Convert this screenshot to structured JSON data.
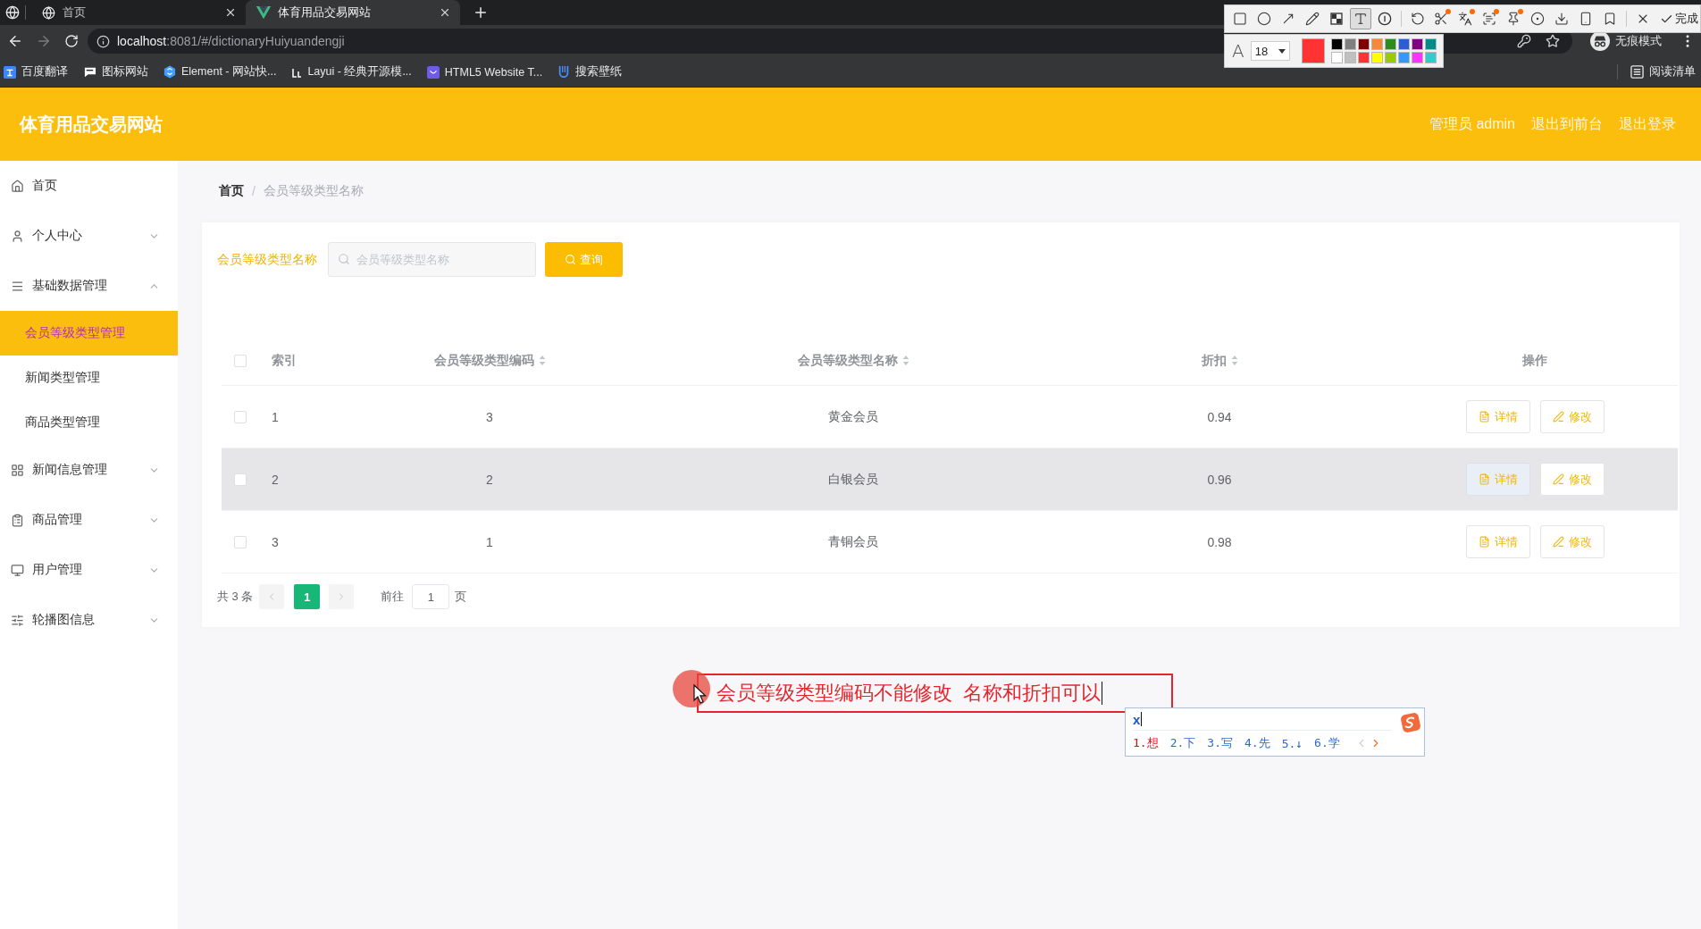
{
  "browser": {
    "tabs": [
      {
        "title": "首页",
        "selected": false
      },
      {
        "title": "体育用品交易网站",
        "selected": true
      }
    ],
    "address": {
      "host": "localhost",
      "path": ":8081/#/dictionaryHuiyuandengji"
    },
    "profile": "无痕模式",
    "bookmarks": [
      "百度翻译",
      "图标网站",
      "Element - 网站快...",
      "Layui - 经典开源模...",
      "HTML5 Website T...",
      "搜索壁纸"
    ],
    "reading_list": "阅读清单"
  },
  "capture_toolbar": {
    "tools": [
      {
        "selected": false,
        "badge": false
      },
      {
        "selected": false,
        "badge": false
      },
      {
        "selected": false,
        "badge": false
      },
      {
        "selected": false,
        "badge": false
      },
      {
        "selected": false,
        "badge": false
      },
      {
        "selected": true,
        "badge": false
      },
      {
        "selected": false,
        "badge": false
      },
      {
        "selected": false,
        "badge": false
      },
      {
        "selected": false,
        "badge": true
      },
      {
        "selected": false,
        "badge": true
      },
      {
        "selected": false,
        "badge": true
      },
      {
        "selected": false,
        "badge": true
      },
      {
        "selected": false,
        "badge": false
      },
      {
        "selected": false,
        "badge": false
      },
      {
        "selected": false,
        "badge": false
      },
      {
        "selected": false,
        "badge": false
      },
      {
        "selected": false,
        "badge": false
      }
    ],
    "done_label": "完成",
    "size_glyph": "A",
    "font_size": "18",
    "palette": [
      {
        "color": "#000000"
      },
      {
        "color": "#808080"
      },
      {
        "color": "#800000"
      },
      {
        "color": "#f7883a"
      },
      {
        "color": "#2e8b22"
      },
      {
        "color": "#2e5bd8"
      },
      {
        "color": "#800080"
      },
      {
        "color": "#008b8b"
      },
      {
        "color": "#ffffff"
      },
      {
        "color": "#c0c0c0"
      },
      {
        "color": "#ff3333"
      },
      {
        "color": "#ffff00"
      },
      {
        "color": "#99cc00"
      },
      {
        "color": "#3399ff"
      },
      {
        "color": "#ff33ff"
      },
      {
        "color": "#33cccc"
      }
    ]
  },
  "header": {
    "title": "体育用品交易网站",
    "links": [
      "管理员 admin",
      "退出到前台",
      "退出登录"
    ]
  },
  "sidebar": {
    "items": [
      {
        "label": "首页",
        "selected": false
      },
      {
        "label": "个人中心",
        "selected": false,
        "expanded": false
      },
      {
        "label": "基础数据管理",
        "selected": false,
        "expanded": true,
        "children": [
          {
            "label": "会员等级类型管理",
            "selected": true
          },
          {
            "label": "新闻类型管理",
            "selected": false
          },
          {
            "label": "商品类型管理",
            "selected": false
          }
        ]
      },
      {
        "label": "新闻信息管理",
        "selected": false,
        "expanded": false
      },
      {
        "label": "商品管理",
        "selected": false,
        "expanded": false
      },
      {
        "label": "用户管理",
        "selected": false,
        "expanded": false
      },
      {
        "label": "轮播图信息",
        "selected": false,
        "expanded": false
      }
    ]
  },
  "breadcrumb": {
    "items": [
      "首页",
      "会员等级类型名称"
    ],
    "separator": "/"
  },
  "search": {
    "label": "会员等级类型名称",
    "placeholder": "会员等级类型名称",
    "button": "查询"
  },
  "table": {
    "select_all": {
      "checked": false
    },
    "columns": [
      {
        "label": "索引",
        "sortable": false
      },
      {
        "label": "会员等级类型编码",
        "sortable": true
      },
      {
        "label": "会员等级类型名称",
        "sortable": true
      },
      {
        "label": "折扣",
        "sortable": true
      },
      {
        "label": "操作",
        "sortable": false
      }
    ],
    "rows": [
      {
        "checked": false,
        "highlighted": false,
        "cells": [
          "1",
          "3",
          "黄金会员",
          "0.94"
        ],
        "actions": [
          {
            "label": "详情",
            "focused": false
          },
          {
            "label": "修改",
            "focused": false
          }
        ]
      },
      {
        "checked": false,
        "highlighted": true,
        "cells": [
          "2",
          "2",
          "白银会员",
          "0.96"
        ],
        "actions": [
          {
            "label": "详情",
            "focused": true
          },
          {
            "label": "修改",
            "focused": false
          }
        ]
      },
      {
        "checked": false,
        "highlighted": false,
        "cells": [
          "3",
          "1",
          "青铜会员",
          "0.98"
        ],
        "actions": [
          {
            "label": "详情",
            "focused": false
          },
          {
            "label": "修改",
            "focused": false
          }
        ]
      }
    ]
  },
  "pagination": {
    "total": "共 3 条",
    "prev_disabled": true,
    "pages": [
      {
        "label": "1",
        "selected": true
      }
    ],
    "next_disabled": true,
    "goto_label": "前往",
    "goto_value": "1",
    "page_suffix": "页"
  },
  "annotation": {
    "text": "会员等级类型编码不能修改  名称和折扣可以"
  },
  "ime": {
    "input": "x",
    "candidates": [
      {
        "label": "1.想",
        "selected": true
      },
      {
        "label": "2.下",
        "selected": false
      },
      {
        "label": "3.写",
        "selected": false
      },
      {
        "label": "4.先",
        "selected": false
      },
      {
        "label": "5.↓",
        "selected": false
      },
      {
        "label": "6.学",
        "selected": false
      }
    ],
    "prev_disabled": true,
    "next_disabled": false
  }
}
